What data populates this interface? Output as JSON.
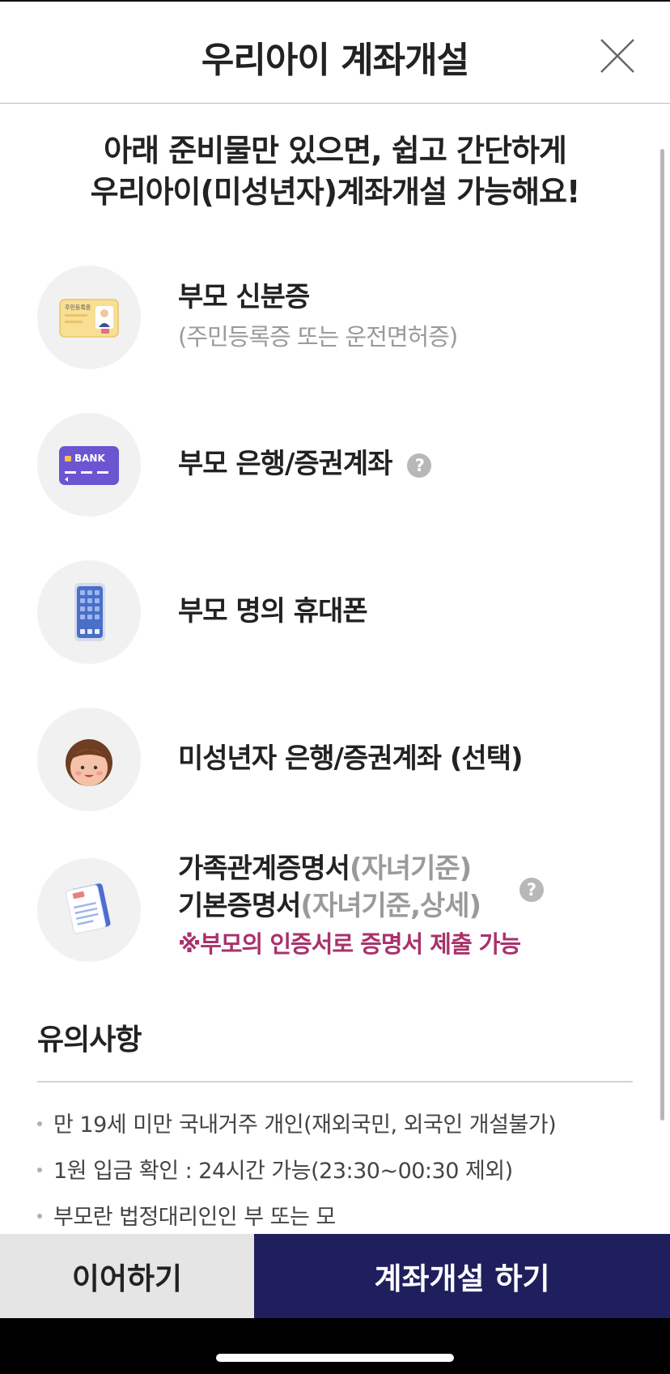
{
  "header": {
    "title": "우리아이 계좌개설"
  },
  "intro": {
    "line1": "아래 준비물만 있으면, 쉽고 간단하게",
    "line2": "우리아이(미성년자)계좌개설 가능해요!"
  },
  "items": [
    {
      "title": "부모 신분증",
      "subtitle": "(주민등록증 또는 운전면허증)",
      "icon": "id-card-icon",
      "icon_text": "주민등록증"
    },
    {
      "title": "부모 은행/증권계좌",
      "help": "?",
      "icon": "bank-card-icon",
      "icon_text": "BANK"
    },
    {
      "title": "부모 명의 휴대폰",
      "icon": "phone-icon"
    },
    {
      "title": "미성년자 은행/증권계좌 (선택)",
      "icon": "child-face-icon"
    },
    {
      "title1": "가족관계증명서",
      "title1_suffix": "(자녀기준)",
      "title2": "기본증명서",
      "title2_suffix": "(자녀기준,상세)",
      "help": "?",
      "note": "※부모의 인증서로 증명서 제출 가능",
      "icon": "document-icon"
    }
  ],
  "notice": {
    "title": "유의사항",
    "items": [
      "만 19세 미만 국내거주 개인(재외국민, 외국인 개설불가)",
      "1원 입금 확인 : 24시간 가능(23:30~00:30 제외)",
      "부모란 법정대리인인 부 또는 모"
    ]
  },
  "buttons": {
    "continue": "이어하기",
    "open": "계좌개설 하기"
  },
  "colors": {
    "primary": "#1f1f5e",
    "accent_pink": "#a8326b",
    "secondary_button": "#e5e5e5"
  }
}
